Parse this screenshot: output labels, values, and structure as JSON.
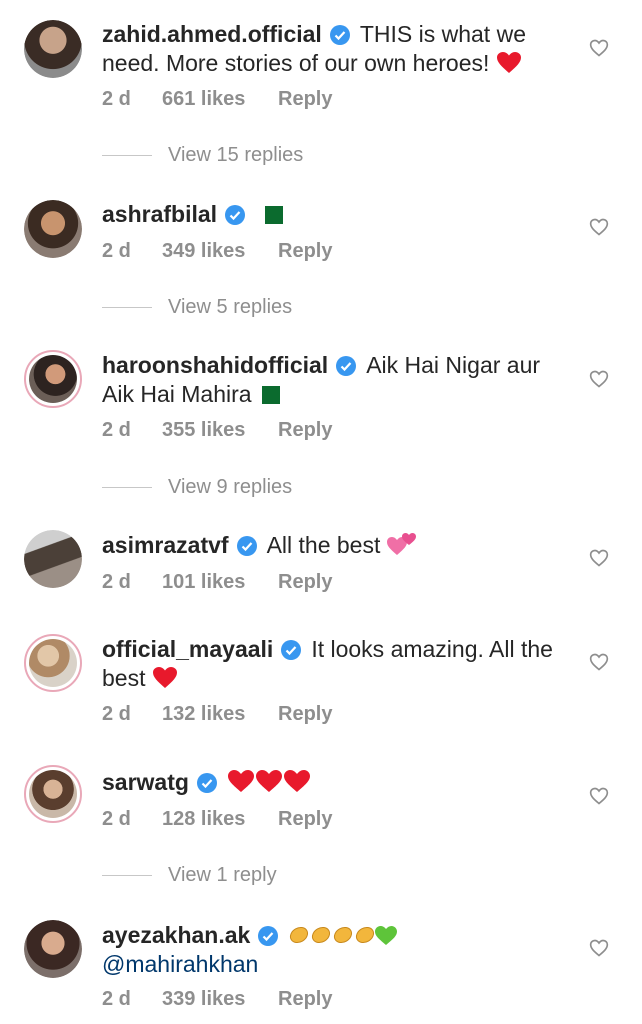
{
  "comments": [
    {
      "username": "zahid.ahmed.official",
      "line1": "THIS is what we",
      "line2": "need. More stories of our own heroes!",
      "time": "2 d",
      "likes": "661 likes",
      "reply": "Reply",
      "replies": "View 15 replies"
    },
    {
      "username": "ashrafbilal",
      "time": "2 d",
      "likes": "349 likes",
      "reply": "Reply",
      "replies": "View 5 replies"
    },
    {
      "username": "haroonshahidofficial",
      "line1": "Aik Hai Nigar aur",
      "line2": "Aik Hai Mahira",
      "time": "2 d",
      "likes": "355 likes",
      "reply": "Reply",
      "replies": "View 9 replies"
    },
    {
      "username": "asimrazatvf",
      "line1": "All the best",
      "time": "2 d",
      "likes": "101 likes",
      "reply": "Reply"
    },
    {
      "username": "official_mayaali",
      "line1": "It looks amazing. All the",
      "line2": "best",
      "time": "2 d",
      "likes": "132 likes",
      "reply": "Reply"
    },
    {
      "username": "sarwatg",
      "time": "2 d",
      "likes": "128 likes",
      "reply": "Reply",
      "replies": "View 1 reply"
    },
    {
      "username": "ayezakhan.ak",
      "mention": "@mahirahkhan",
      "time": "2 d",
      "likes": "339 likes",
      "reply": "Reply"
    }
  ],
  "colors": {
    "text": "#262626",
    "secondary": "#8e8e8e",
    "verified": "#3897f0",
    "heart": "#ed4956",
    "mention": "#00376b"
  }
}
